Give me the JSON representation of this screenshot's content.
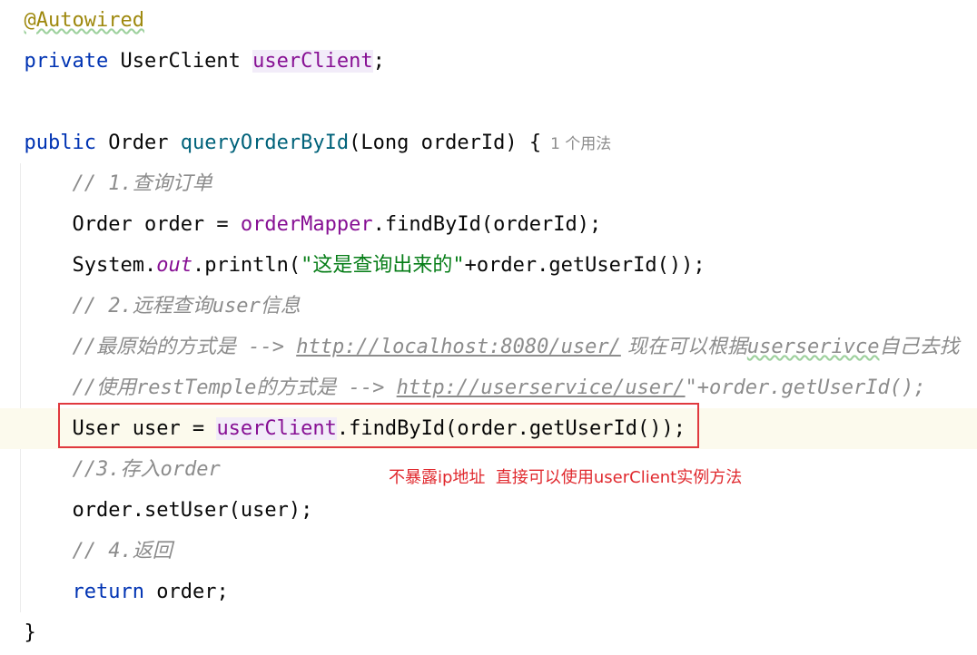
{
  "code": {
    "line1": {
      "annotation": "@Autowired"
    },
    "line2": {
      "kw": "private",
      "type": " UserClient ",
      "field": "userClient",
      "end": ";"
    },
    "line4": {
      "kw": "public",
      "type": " Order ",
      "method": "queryOrderById",
      "params": "(Long orderId) {",
      "usage_hint": "1 个用法"
    },
    "line5": {
      "comment": "// 1.查询订单"
    },
    "line6": {
      "pre": "Order order = ",
      "field": "orderMapper",
      "post": ".findById(orderId);"
    },
    "line7": {
      "pre": "System.",
      "static_field": "out",
      "mid": ".println(",
      "string": "\"这是查询出来的\"",
      "post": "+order.getUserId());"
    },
    "line8": {
      "comment": "// 2.远程查询user信息"
    },
    "line9": {
      "comment_pre": "//最原始的方式是 --> ",
      "url": "http://localhost:8080/user/",
      "comment_post": " 现在可以根据",
      "typo_word": "userserivce",
      "comment_end": "自己去找"
    },
    "line10": {
      "comment_pre": "//使用restTemple的方式是 --> ",
      "url": "http://userservice/user/",
      "comment_post": "\"+order.getUserId();"
    },
    "line11": {
      "pre": "User user = ",
      "field": "userClient",
      "post": ".findById(order.getUserId());"
    },
    "line12": {
      "comment": "//3.存入order"
    },
    "line13": {
      "code": "order.setUser(user);"
    },
    "line14": {
      "comment": "// 4.返回"
    },
    "line15": {
      "kw": "return",
      "post": " order;"
    },
    "line16": {
      "brace": "}"
    }
  },
  "annotation_note": "不暴露ip地址  直接可以使用userClient实例方法",
  "colors": {
    "keyword": "#0033b3",
    "annotation": "#9e880d",
    "field": "#871094",
    "method": "#00627a",
    "string": "#067d17",
    "comment": "#8c8c8c",
    "highlight_box": "#e0393e",
    "callout_text": "#e0292e",
    "current_line": "#fcfaed"
  }
}
